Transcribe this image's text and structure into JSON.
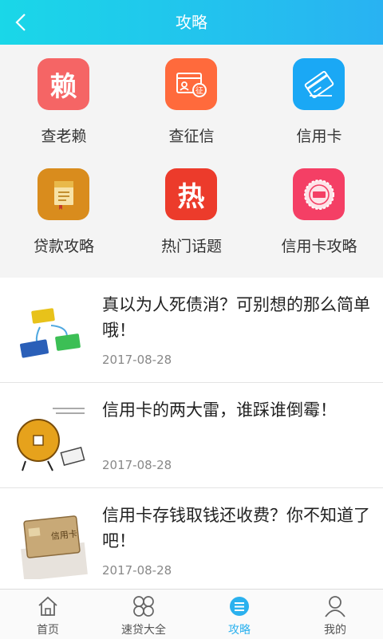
{
  "header": {
    "title": "攻略"
  },
  "grid": [
    {
      "label": "查老赖",
      "icon": "lai-icon",
      "glyph": "赖",
      "color": "#f56565"
    },
    {
      "label": "查征信",
      "icon": "credit-report-icon",
      "color": "#ff6a3c"
    },
    {
      "label": "信用卡",
      "icon": "credit-card-icon",
      "color": "#1aa8f5"
    },
    {
      "label": "贷款攻略",
      "icon": "loan-guide-icon",
      "color": "#d98c1d"
    },
    {
      "label": "热门话题",
      "icon": "hot-topic-icon",
      "glyph": "热",
      "color": "#ec3b2b"
    },
    {
      "label": "信用卡攻略",
      "icon": "card-guide-badge-icon",
      "color": "#f43f65"
    }
  ],
  "articles": [
    {
      "title": "真以为人死债消？可别想的那么简单哦！",
      "date": "2017-08-28"
    },
    {
      "title": "信用卡的两大雷，谁踩谁倒霉！",
      "date": "2017-08-28"
    },
    {
      "title": "信用卡存钱取钱还收费？你不知道了吧！",
      "date": "2017-08-28"
    }
  ],
  "tabs": [
    {
      "label": "首页",
      "icon": "home-icon"
    },
    {
      "label": "速贷大全",
      "icon": "clover-icon"
    },
    {
      "label": "攻略",
      "icon": "guide-icon",
      "active": true
    },
    {
      "label": "我的",
      "icon": "user-icon"
    }
  ],
  "colors": {
    "accent": "#2bb1ee",
    "header_from": "#1ad7e8",
    "header_to": "#29b2f2"
  }
}
